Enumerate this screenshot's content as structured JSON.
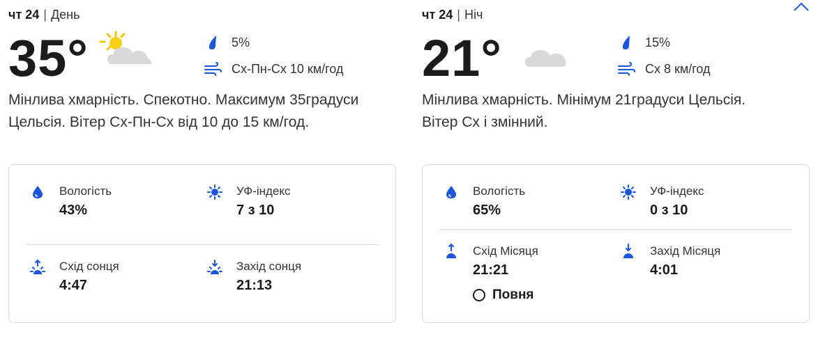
{
  "day": {
    "weekday": "чт 24",
    "period": "День",
    "temperature": "35°",
    "precip": "5%",
    "wind": "Сх-Пн-Сх 10 км/год",
    "description": "Мінлива хмарність. Спекотно. Максимум 35градуси Цельсія. Вітер Сх-Пн-Сх від 10 до 15 км/год.",
    "humidity_label": "Вологість",
    "humidity_value": "43%",
    "uv_label": "УФ-індекс",
    "uv_value": "7 з 10",
    "rise_label": "Схід сонця",
    "rise_value": "4:47",
    "set_label": "Захід сонця",
    "set_value": "21:13",
    "icon": "partly-cloudy-sun-icon"
  },
  "night": {
    "weekday": "чт 24",
    "period": "Ніч",
    "temperature": "21°",
    "precip": "15%",
    "wind": "Сх 8 км/год",
    "description": "Мінлива хмарність. Мінімум 21градуси Цельсія. Вітер Сх і змінний.",
    "humidity_label": "Вологість",
    "humidity_value": "65%",
    "uv_label": "УФ-індекс",
    "uv_value": "0 з 10",
    "rise_label": "Схід Місяця",
    "rise_value": "21:21",
    "set_label": "Захід Місяця",
    "set_value": "4:01",
    "moon_phase": "Повня",
    "icon": "partly-cloudy-moon-icon"
  },
  "colors": {
    "accent": "#1a56db",
    "text": "#1b1b1b",
    "muted": "#333333",
    "border": "#dcdcdc"
  }
}
